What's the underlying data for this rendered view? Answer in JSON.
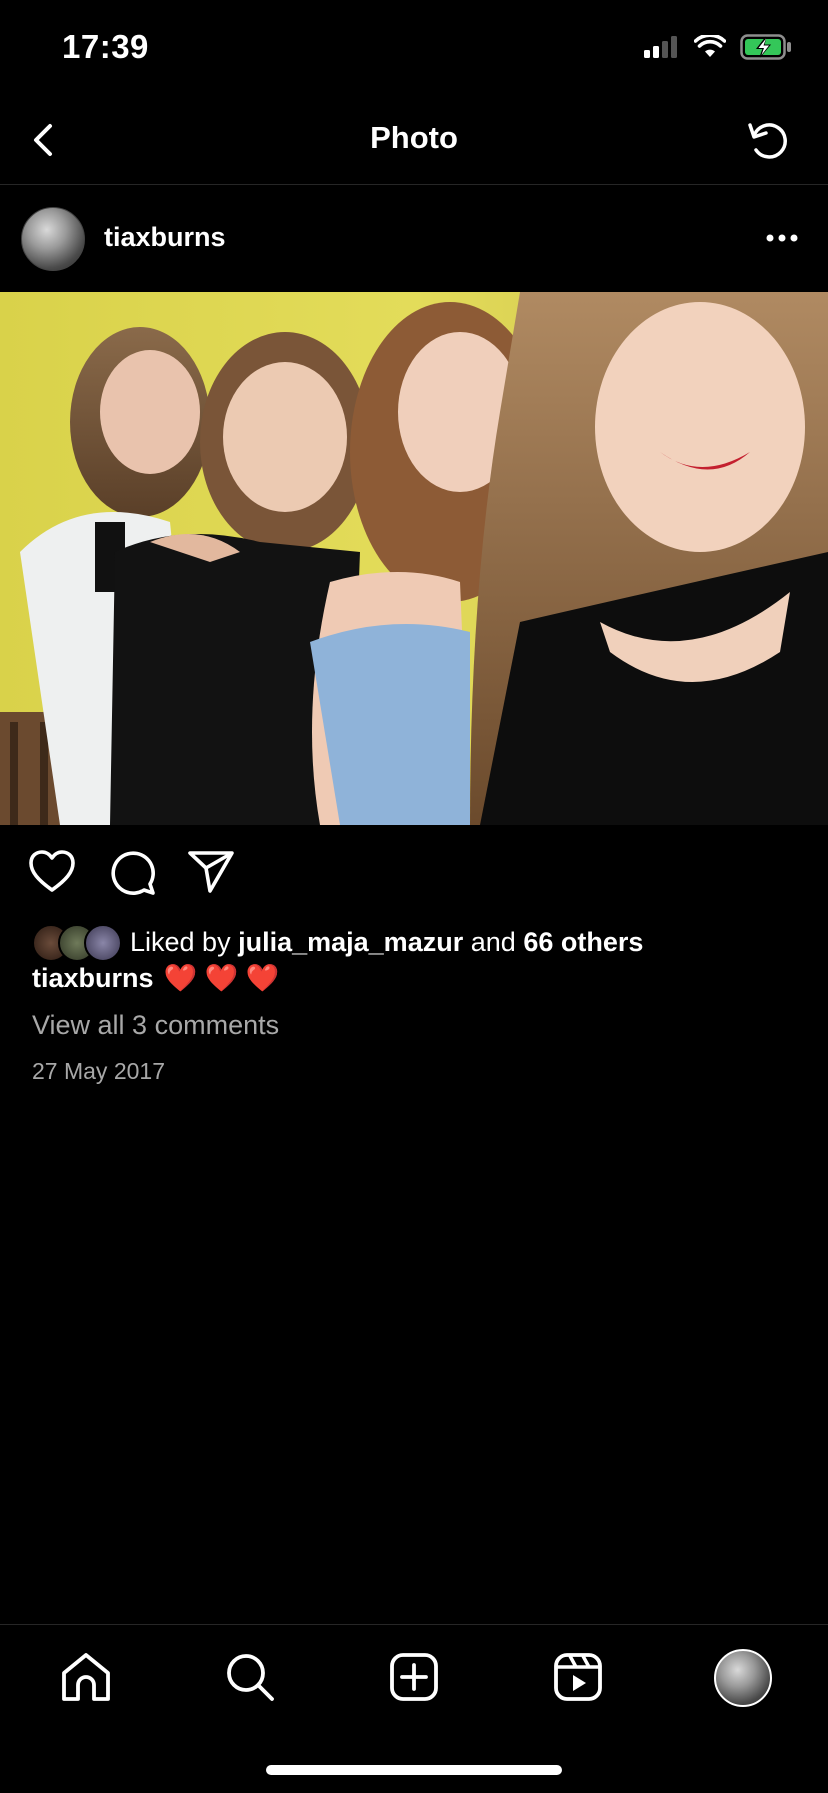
{
  "status": {
    "time": "17:39"
  },
  "nav": {
    "title": "Photo"
  },
  "post": {
    "username": "tiaxburns",
    "liked_by_prefix": "Liked by",
    "liked_by_user": "julia_maja_mazur",
    "liked_by_and": "and",
    "liked_by_others": "66 others",
    "caption_user": "tiaxburns",
    "caption_text": "❤️ ❤️ ❤️",
    "view_comments": "View all 3 comments",
    "date": "27 May 2017"
  },
  "colors": {
    "background": "#000000",
    "text": "#ffffff",
    "muted": "#a8a8a8",
    "battery": "#34c759"
  },
  "icons": [
    "back-icon",
    "refresh-icon",
    "more-icon",
    "heart-icon",
    "comment-icon",
    "share-icon",
    "home-icon",
    "search-icon",
    "create-icon",
    "reels-icon"
  ]
}
